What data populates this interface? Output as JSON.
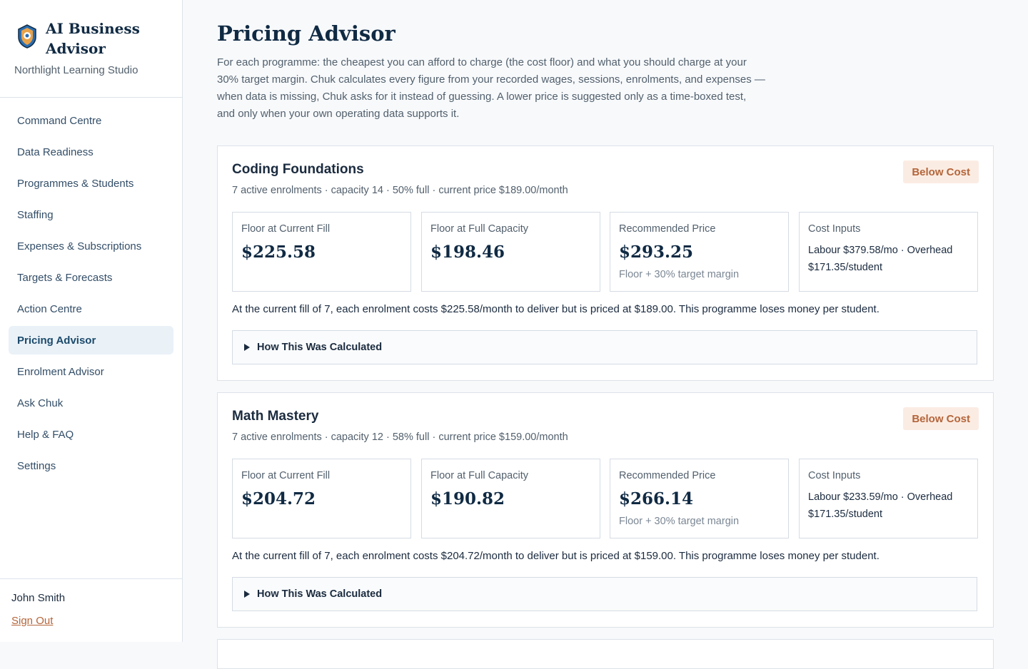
{
  "sidebar": {
    "app_title": "AI Business Advisor",
    "org_name": "Northlight Learning Studio",
    "nav": [
      {
        "label": "Command Centre"
      },
      {
        "label": "Data Readiness"
      },
      {
        "label": "Programmes & Students"
      },
      {
        "label": "Staffing"
      },
      {
        "label": "Expenses & Subscriptions"
      },
      {
        "label": "Targets & Forecasts"
      },
      {
        "label": "Action Centre"
      },
      {
        "label": "Pricing Advisor",
        "active": true
      },
      {
        "label": "Enrolment Advisor"
      },
      {
        "label": "Ask Chuk"
      },
      {
        "label": "Help & FAQ"
      },
      {
        "label": "Settings"
      }
    ],
    "user_name": "John Smith",
    "sign_out_label": "Sign Out"
  },
  "page": {
    "title": "Pricing Advisor",
    "description": "For each programme: the cheapest you can afford to charge (the cost floor) and what you should charge at your 30% target margin. Chuk calculates every figure from your recorded wages, sessions, enrolments, and expenses — when data is missing, Chuk asks for it instead of guessing. A lower price is suggested only as a time-boxed test, and only when your own operating data supports it."
  },
  "programmes": [
    {
      "name": "Coding Foundations",
      "meta": "7 active enrolments · capacity 14 · 50% full · current price $189.00/month",
      "badge": "Below Cost",
      "floor_current_label": "Floor at Current Fill",
      "floor_current_value": "$225.58",
      "floor_full_label": "Floor at Full Capacity",
      "floor_full_value": "$198.46",
      "recommended_label": "Recommended Price",
      "recommended_value": "$293.25",
      "recommended_note": "Floor + 30% target margin",
      "cost_inputs_label": "Cost Inputs",
      "cost_inputs_text": "Labour $379.58/mo · Overhead $171.35/student",
      "summary": "At the current fill of 7, each enrolment costs $225.58/month to deliver but is priced at $189.00. This programme loses money per student.",
      "details_label": "How This Was Calculated"
    },
    {
      "name": "Math Mastery",
      "meta": "7 active enrolments · capacity 12 · 58% full · current price $159.00/month",
      "badge": "Below Cost",
      "floor_current_label": "Floor at Current Fill",
      "floor_current_value": "$204.72",
      "floor_full_label": "Floor at Full Capacity",
      "floor_full_value": "$190.82",
      "recommended_label": "Recommended Price",
      "recommended_value": "$266.14",
      "recommended_note": "Floor + 30% target margin",
      "cost_inputs_label": "Cost Inputs",
      "cost_inputs_text": "Labour $233.59/mo · Overhead $171.35/student",
      "summary": "At the current fill of 7, each enrolment costs $204.72/month to deliver but is priced at $159.00. This programme loses money per student.",
      "details_label": "How This Was Calculated"
    }
  ],
  "colors": {
    "accent": "#1b4a6b",
    "badge_bg": "#fbece3",
    "badge_text": "#b4653a"
  }
}
